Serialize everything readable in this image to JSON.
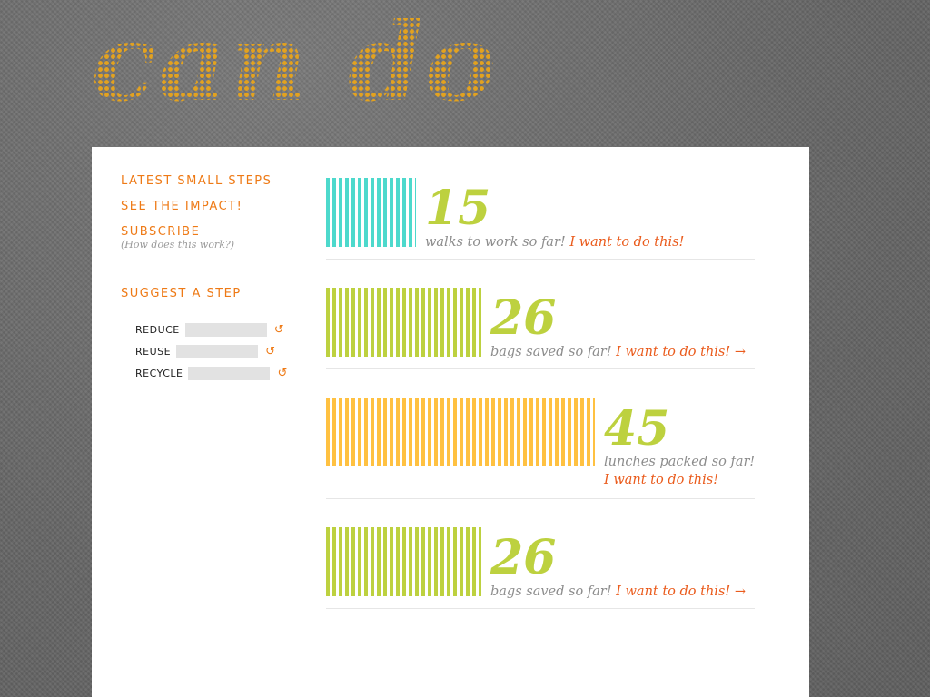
{
  "logo": "can do",
  "sidebar": {
    "links": [
      {
        "label": "Latest small steps"
      },
      {
        "label": "See the impact!"
      },
      {
        "label": "Subscribe",
        "note": "(How does this work?)"
      }
    ],
    "suggest": {
      "title": "Suggest a step",
      "fields": [
        {
          "label": "Reduce",
          "value": ""
        },
        {
          "label": "Reuse",
          "value": ""
        },
        {
          "label": "Recycle",
          "value": ""
        }
      ],
      "refresh_icon": "↺"
    }
  },
  "steps": [
    {
      "count": "15",
      "text": "walks to work so far!",
      "cta": "I want to do this!",
      "arrow": "",
      "color": "#4dd9cc",
      "value": 15
    },
    {
      "count": "26",
      "text": "bags saved so far!",
      "cta": "I want to do this!",
      "arrow": "→",
      "color": "#bdd13f",
      "value": 26
    },
    {
      "count": "45",
      "text": "lunches packed so far!",
      "cta": "I want to do this!",
      "arrow": "",
      "color": "#ffc141",
      "value": 45,
      "wrap": true
    },
    {
      "count": "26",
      "text": "bags saved so far!",
      "cta": "I want to do this!",
      "arrow": "→",
      "color": "#bdd13f",
      "value": 26
    }
  ],
  "colors": {
    "accent": "#ee7a16",
    "cta": "#ea5b1c",
    "count_green": "#bdd13f",
    "logo": "#e3a21f"
  }
}
